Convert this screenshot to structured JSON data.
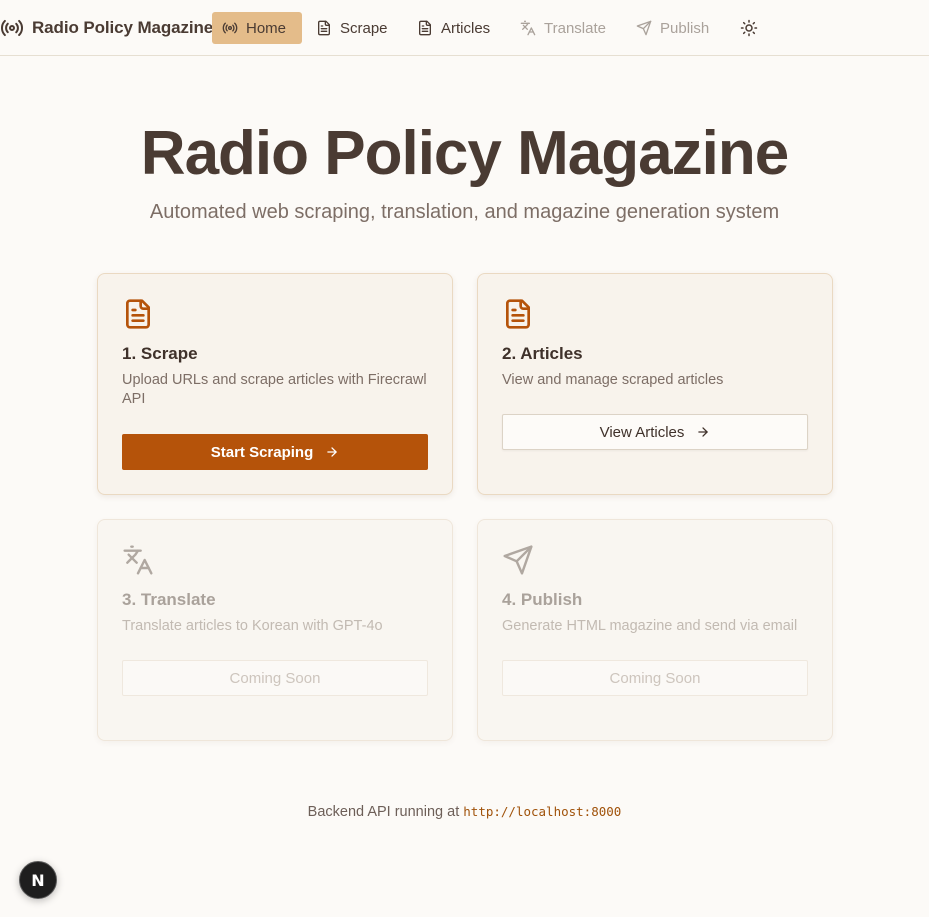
{
  "colors": {
    "accent": "#b5530a",
    "nav_active_bg": "#e4bc8a",
    "text_primary": "#4a3b33",
    "text_muted": "#7d6e66",
    "disabled": "#aaa29b",
    "page_bg": "#fcfaf7"
  },
  "nav": {
    "brand": {
      "title": "Radio Policy Magazine",
      "icon": "radio-broadcast-icon"
    },
    "items": [
      {
        "label": "Home",
        "icon": "radio-broadcast-icon",
        "state": "active"
      },
      {
        "label": "Scrape",
        "icon": "document-icon",
        "state": "normal"
      },
      {
        "label": "Articles",
        "icon": "document-icon",
        "state": "normal"
      },
      {
        "label": "Translate",
        "icon": "translate-icon",
        "state": "disabled"
      },
      {
        "label": "Publish",
        "icon": "send-icon",
        "state": "disabled"
      }
    ],
    "theme_toggle_icon": "sun-icon"
  },
  "hero": {
    "title": "Radio Policy Magazine",
    "subtitle": "Automated web scraping, translation, and magazine generation system"
  },
  "cards": [
    {
      "icon": "document-icon",
      "title": "1. Scrape",
      "description": "Upload URLs and scrape articles with Firecrawl API",
      "button_label": "Start Scraping",
      "button_style": "primary",
      "enabled": true
    },
    {
      "icon": "document-icon",
      "title": "2. Articles",
      "description": "View and manage scraped articles",
      "button_label": "View Articles",
      "button_style": "outline",
      "enabled": true
    },
    {
      "icon": "translate-icon",
      "title": "3. Translate",
      "description": "Translate articles to Korean with GPT-4o",
      "button_label": "Coming Soon",
      "button_style": "disabled",
      "enabled": false
    },
    {
      "icon": "send-icon",
      "title": "4. Publish",
      "description": "Generate HTML magazine and send via email",
      "button_label": "Coming Soon",
      "button_style": "disabled",
      "enabled": false
    }
  ],
  "footer": {
    "text": "Backend API running at",
    "url": "http://localhost:8000"
  },
  "dev_badge": {
    "label": "N"
  }
}
